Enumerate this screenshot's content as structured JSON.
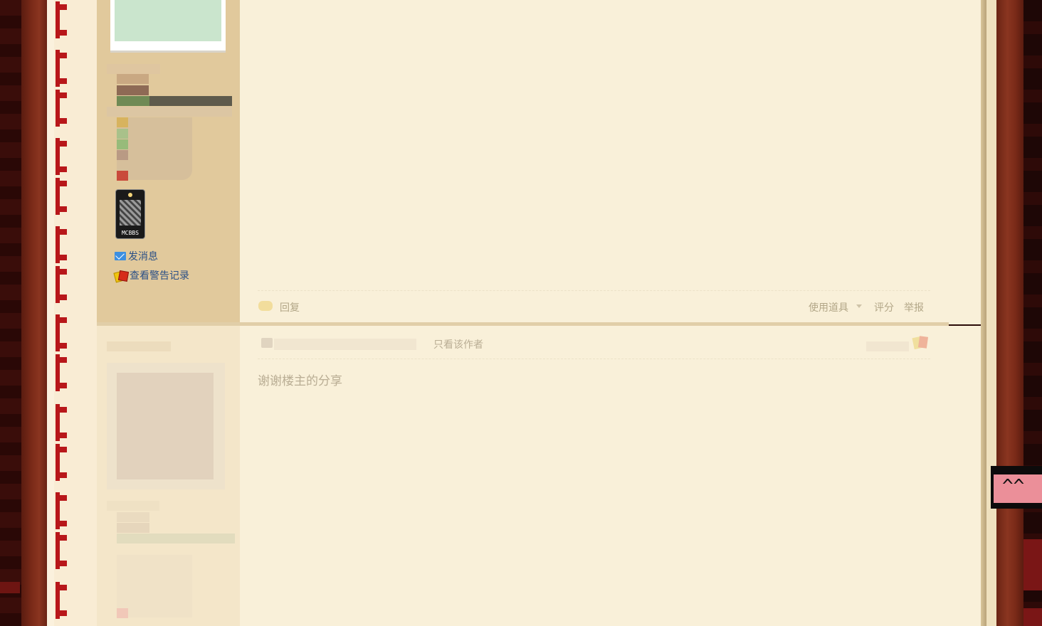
{
  "sidebar": {
    "badge_text": "MCBBS",
    "links": [
      {
        "label": "发消息",
        "icon": "mail-icon"
      },
      {
        "label": "查看警告记录",
        "icon": "warning-card-icon"
      }
    ]
  },
  "post_actions": {
    "reply": "回复",
    "use_tool": "使用道具",
    "rate": "评分",
    "report": "举报"
  },
  "second_post": {
    "only_author": "只看该作者",
    "body": "谢谢楼主的分享"
  },
  "colors": {
    "sidebar_bg": "#e1c99c",
    "content_bg": "#f9f0d9",
    "link": "#2a4f86",
    "chain_red": "#b8171a",
    "wood": "#7a2a18"
  }
}
